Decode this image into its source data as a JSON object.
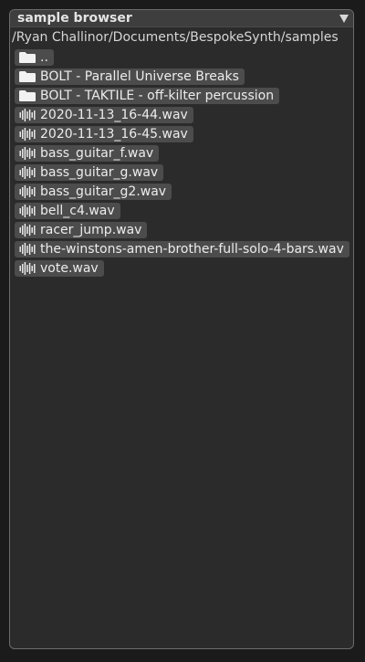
{
  "panel": {
    "title": "sample browser",
    "collapse_icon": "triangle-down-icon",
    "path": "/Ryan Challinor/Documents/BespokeSynth/samples"
  },
  "items": [
    {
      "type": "folder",
      "icon": "folder-icon",
      "label": ".."
    },
    {
      "type": "folder",
      "icon": "folder-icon",
      "label": "BOLT - Parallel Universe Breaks"
    },
    {
      "type": "folder",
      "icon": "folder-icon",
      "label": "BOLT - TAKTILE - off-kilter percussion"
    },
    {
      "type": "file",
      "icon": "waveform-icon",
      "label": "2020-11-13_16-44.wav"
    },
    {
      "type": "file",
      "icon": "waveform-icon",
      "label": "2020-11-13_16-45.wav"
    },
    {
      "type": "file",
      "icon": "waveform-icon",
      "label": "bass_guitar_f.wav"
    },
    {
      "type": "file",
      "icon": "waveform-icon",
      "label": "bass_guitar_g.wav"
    },
    {
      "type": "file",
      "icon": "waveform-icon",
      "label": "bass_guitar_g2.wav"
    },
    {
      "type": "file",
      "icon": "waveform-icon",
      "label": "bell_c4.wav"
    },
    {
      "type": "file",
      "icon": "waveform-icon",
      "label": "racer_jump.wav"
    },
    {
      "type": "file",
      "icon": "waveform-icon",
      "label": "the-winstons-amen-brother-full-solo-4-bars.wav"
    },
    {
      "type": "file",
      "icon": "waveform-icon",
      "label": "vote.wav"
    }
  ]
}
